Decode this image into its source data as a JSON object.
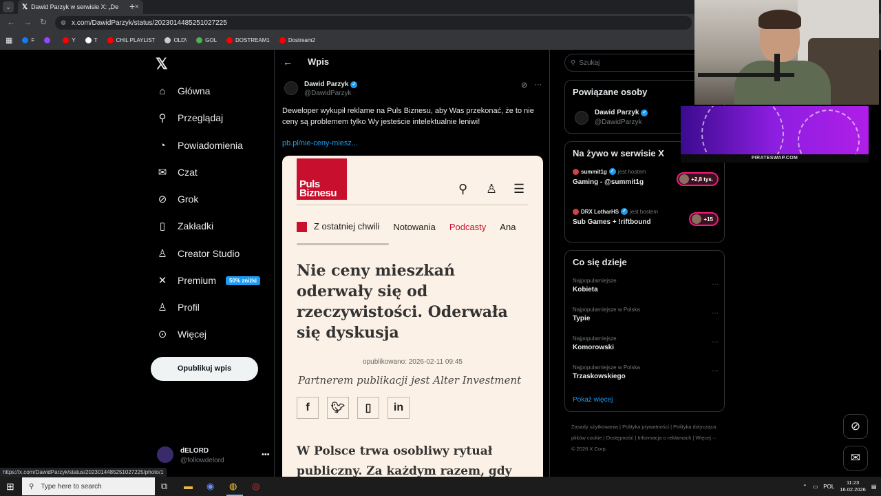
{
  "browser": {
    "tab_title": "Dawid Parzyk w serwisie X: „De",
    "url": "x.com/DawidParzyk/status/2023014485251027225",
    "bookmarks": [
      {
        "label": "F",
        "color": "#1877f2"
      },
      {
        "label": "",
        "color": "#9146ff"
      },
      {
        "label": "Y",
        "color": "#ff0000"
      },
      {
        "label": "T",
        "color": "#ffffff"
      },
      {
        "label": "CHIL PLAYLIST",
        "color": "#ff0000"
      },
      {
        "label": "OLD\\",
        "color": "#cccccc"
      },
      {
        "label": "GOL",
        "color": "#4caf50"
      },
      {
        "label": "DOSTREAM1",
        "color": "#ff0000"
      },
      {
        "label": "Dostream2",
        "color": "#ff0000"
      }
    ],
    "status_url": "https://x.com/DawidParzyk/status/2023014485251027225/photo/1"
  },
  "nav": {
    "items": [
      {
        "label": "Główna",
        "icon": "home-icon",
        "glyph": "⌂"
      },
      {
        "label": "Przeglądaj",
        "icon": "search-icon",
        "glyph": "⚲"
      },
      {
        "label": "Powiadomienia",
        "icon": "bell-icon",
        "glyph": "◔"
      },
      {
        "label": "Czat",
        "icon": "mail-icon",
        "glyph": "✉"
      },
      {
        "label": "Grok",
        "icon": "grok-icon",
        "glyph": "⊘"
      },
      {
        "label": "Zakładki",
        "icon": "bookmark-icon",
        "glyph": "▯"
      },
      {
        "label": "Creator Studio",
        "icon": "creator-icon",
        "glyph": "♙"
      },
      {
        "label": "Premium",
        "icon": "x-premium-icon",
        "glyph": "✕"
      },
      {
        "label": "Profil",
        "icon": "profile-icon",
        "glyph": "♙"
      },
      {
        "label": "Więcej",
        "icon": "more-circle-icon",
        "glyph": "⊙"
      }
    ],
    "premium_badge": "50% zniżki",
    "publish_label": "Opublikuj wpis",
    "account": {
      "name": "dELORD",
      "handle": "@followdelord"
    }
  },
  "post": {
    "header": "Wpis",
    "author_name": "Dawid Parzyk",
    "author_handle": "@DawidParzyk",
    "text": "Deweloper wykupił reklame na Puls Biznesu, aby Was przekonać, że to nie ceny są problemem tylko Wy jesteście intelektualnie leniwi!",
    "link": "pb.pl/nie-ceny-miesz..."
  },
  "article": {
    "logo_line1": "Puls",
    "logo_line2": "Biznesu",
    "menu": [
      "Z ostatniej chwili",
      "Notowania",
      "Podcasty",
      "Ana"
    ],
    "headline": "Nie ceny mieszkań oderwały się od rzeczywistości. Oderwała się dyskusja",
    "published": "opublikowano: 2026-02-11 09:45",
    "partner": "Partnerem publikacji jest Alter Investment",
    "lead": "W Polsce trwa osobliwy rytuał publiczny. Za każdym razem, gdy"
  },
  "sidebar": {
    "search_placeholder": "Szukaj",
    "related_title": "Powiązane osoby",
    "related_person": {
      "name": "Dawid Parzyk",
      "handle": "@DawidParzyk"
    },
    "live_title": "Na żywo w serwisie X",
    "live": [
      {
        "host": "summit1g",
        "host_note": "jest hostem",
        "title": "Gaming - @summit1g",
        "count": "+2,8 tys."
      },
      {
        "host": "DRX LotharHS",
        "host_note": "jest hostem",
        "title": "Sub Games + !riftbound",
        "count": "+15"
      }
    ],
    "trends_title": "Co się dzieje",
    "trends": [
      {
        "category": "Najpopularniejsze",
        "name": "Kobieta"
      },
      {
        "category": "Najpopularniejsze w Polska",
        "name": "Typie"
      },
      {
        "category": "Najpopularniejsze",
        "name": "Komorowski"
      },
      {
        "category": "Najpopularniejsze w Polska",
        "name": "Trzaskowskiego"
      }
    ],
    "show_more": "Pokaż więcej",
    "footer": "Zasady użytkowania  |  Polityka prywatności  |  Polityka dotycząca plików cookie  |  Dostępność  |  Informacja o reklamach  |  Więcej ···  © 2026 X Corp."
  },
  "overlay": {
    "ad_text": "PIRATESWAP.COM"
  },
  "taskbar": {
    "search_placeholder": "Type here to search",
    "lang": "POL",
    "time": "11:23",
    "date": "16.02.2026"
  }
}
